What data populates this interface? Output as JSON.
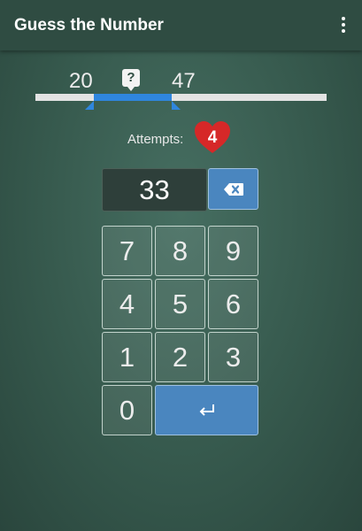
{
  "app_bar": {
    "title": "Guess the Number",
    "menu_icon": "more-vert-icon"
  },
  "range": {
    "low": "20",
    "high": "47",
    "secret_icon": "question-mark-icon",
    "colors": {
      "track": "#e3e3e3",
      "fill": "#2f86de"
    }
  },
  "attempts": {
    "label": "Attempts:",
    "count": "4",
    "heart_color": "#d62828"
  },
  "input": {
    "value": "33",
    "backspace_icon": "backspace-icon"
  },
  "keypad": {
    "keys": [
      "7",
      "8",
      "9",
      "4",
      "5",
      "6",
      "1",
      "2",
      "3",
      "0"
    ],
    "enter_icon": "enter-icon",
    "accent": "#4a86bf"
  }
}
